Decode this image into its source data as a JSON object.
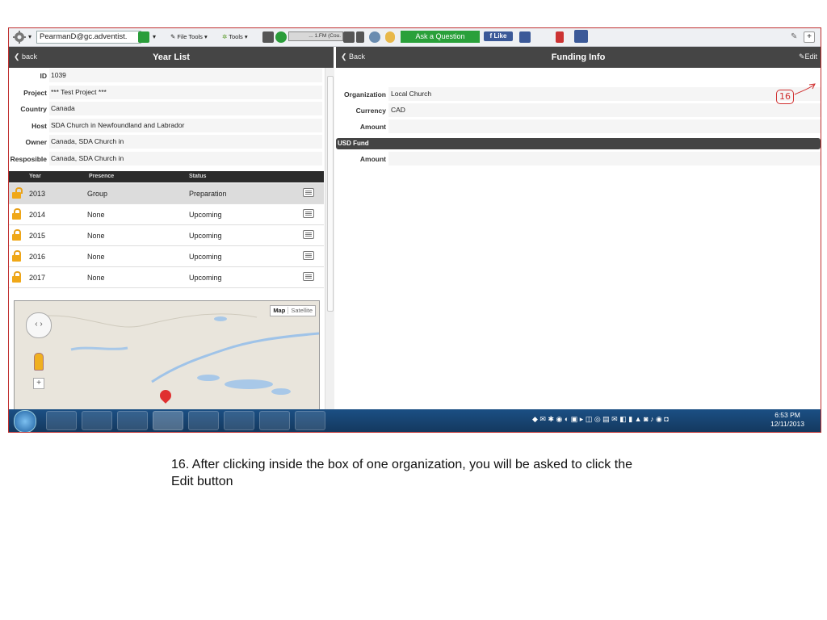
{
  "toolbar": {
    "account": "PearmanD@gc.adventist.",
    "file_tools": "File Tools",
    "tools": "Tools",
    "radio": "... 1.FM (Cou.",
    "ask_button": "Ask a Question",
    "like_button": "Like"
  },
  "left_panel": {
    "back_label": "back",
    "title": "Year List",
    "fields": [
      {
        "label": "ID",
        "value": "1039"
      },
      {
        "label": "Project",
        "value": "*** Test Project ***"
      },
      {
        "label": "Country",
        "value": "Canada"
      },
      {
        "label": "Host",
        "value": "SDA Church in Newfoundland and Labrador"
      },
      {
        "label": "Owner",
        "value": "Canada, SDA Church in"
      },
      {
        "label": "Resposible",
        "value": "Canada, SDA Church in"
      }
    ],
    "table_headers": {
      "year": "Year",
      "presence": "Presence",
      "status": "Status"
    },
    "years": [
      {
        "year": "2013",
        "presence": "Group",
        "status": "Preparation",
        "lock": "open"
      },
      {
        "year": "2014",
        "presence": "None",
        "status": "Upcoming",
        "lock": "closed"
      },
      {
        "year": "2015",
        "presence": "None",
        "status": "Upcoming",
        "lock": "closed"
      },
      {
        "year": "2016",
        "presence": "None",
        "status": "Upcoming",
        "lock": "closed"
      },
      {
        "year": "2017",
        "presence": "None",
        "status": "Upcoming",
        "lock": "closed"
      }
    ],
    "map": {
      "map_label": "Map",
      "satellite_label": "Satellite"
    }
  },
  "right_panel": {
    "back_label": "Back",
    "title": "Funding Info",
    "edit_label": "Edit",
    "fields": [
      {
        "label": "Organization",
        "value": "Local Church"
      },
      {
        "label": "Currency",
        "value": "CAD"
      },
      {
        "label": "Amount",
        "value": ""
      }
    ],
    "usd_section": "USD Fund",
    "usd_amount_label": "Amount",
    "usd_amount_value": "",
    "annotation": "16"
  },
  "taskbar": {
    "time": "6:53 PM",
    "date": "12/11/2013"
  },
  "caption": "16.  After clicking inside the box of one organization, you will be asked to click the Edit button"
}
